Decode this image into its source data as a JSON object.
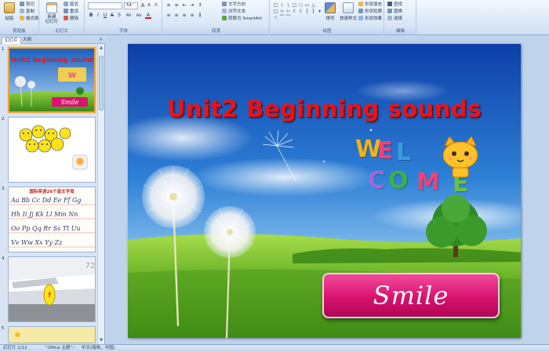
{
  "ribbon": {
    "clipboard": {
      "label": "剪贴板",
      "paste": "粘贴",
      "cut": "剪切",
      "copy": "复制",
      "format_painter": "格式刷"
    },
    "slides": {
      "label": "幻灯片",
      "new_slide": "新建\n幻灯片",
      "layout": "版式",
      "reset": "重设",
      "delete": "删除"
    },
    "font": {
      "label": "字体",
      "size": "54",
      "grow": "A",
      "shrink": "A",
      "clear": "A",
      "bold": "B",
      "italic": "I",
      "underline": "U",
      "strike": "S",
      "shadow": "S",
      "spacing": "AV",
      "case": "Aa",
      "color": "A"
    },
    "paragraph": {
      "label": "段落",
      "text_direction": "文字方向",
      "align_text": "对齐文本",
      "to_smartart": "转换为 SmartArt"
    },
    "drawing": {
      "label": "绘图",
      "arrange": "排列",
      "quick_styles": "快速样式",
      "shape_fill": "形状填充",
      "shape_outline": "形状轮廓",
      "shape_effects": "形状效果"
    },
    "editing": {
      "label": "编辑",
      "find": "查找",
      "replace": "替换",
      "select": "选择"
    }
  },
  "panel": {
    "tabs": [
      "幻灯片",
      "大纲"
    ],
    "close": "×",
    "thumbnails": [
      {
        "number": "1",
        "title": "Unit2 Beginning sounds",
        "smile": "Smile"
      },
      {
        "number": "2"
      },
      {
        "number": "3",
        "header": "国际英语26个音文字母",
        "rows": [
          "Aa Bb Cc Dd Ee Ff Gg",
          "Hh Ii Jj Kk Ll Mm Nn",
          "Oo Pp Qq Rr Ss Tt Uu",
          "Vv Ww Xx Yy Zz"
        ]
      },
      {
        "number": "4",
        "marker": "?",
        "tail": "72"
      },
      {
        "number": "5"
      }
    ]
  },
  "slide": {
    "title": "Unit2 Beginning sounds",
    "welcome": [
      "W",
      "E",
      "L",
      "C",
      "O",
      "M",
      "E"
    ],
    "smile": "Smile"
  },
  "status": {
    "slide_count": "幻灯片 1/12",
    "theme": "\"Office 主题\"",
    "language": "中文(简体，中国)"
  },
  "colors": {
    "title_red": "#e8141c",
    "smile_pink": "#d8126f",
    "ribbon_blue": "#dfeaf8"
  }
}
